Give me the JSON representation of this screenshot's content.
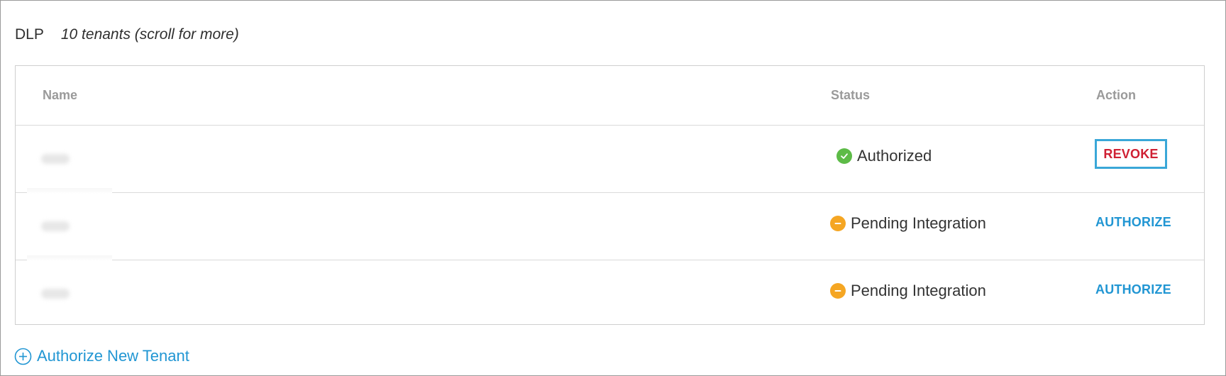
{
  "header": {
    "app_name": "DLP",
    "tenant_count": "10 tenants (scroll for more)"
  },
  "table": {
    "columns": {
      "name": "Name",
      "status": "Status",
      "action": "Action"
    },
    "rows": [
      {
        "name": "abc",
        "status": "Authorized",
        "status_icon": "check-circle-icon",
        "status_color": "#5dbb47",
        "action": "REVOKE"
      },
      {
        "name": "abc",
        "status": "Pending Integration",
        "status_icon": "minus-circle-icon",
        "status_color": "#f5a623",
        "action": "AUTHORIZE"
      },
      {
        "name": "abc",
        "status": "Pending Integration",
        "status_icon": "minus-circle-icon",
        "status_color": "#f5a623",
        "action": "AUTHORIZE"
      }
    ]
  },
  "footer": {
    "add_tenant_label": "Authorize New Tenant",
    "add_tenant_icon": "plus-circle-icon"
  },
  "colors": {
    "link_blue": "#2196d3",
    "revoke_red": "#cf2033",
    "focus_outline": "#3aa7d8"
  }
}
